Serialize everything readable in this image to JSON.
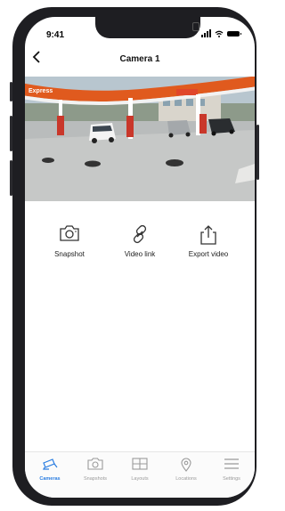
{
  "status_bar": {
    "time": "9:41"
  },
  "header": {
    "title": "Camera 1",
    "back_icon": "chevron-left-icon"
  },
  "video": {
    "description_icon": "camera-feed",
    "station_sign_left": "Express"
  },
  "actions": [
    {
      "label": "Snapshot",
      "icon": "camera-icon"
    },
    {
      "label": "Video link",
      "icon": "link-icon"
    },
    {
      "label": "Export video",
      "icon": "share-icon"
    }
  ],
  "tabs": [
    {
      "label": "Cameras",
      "icon": "cctv-icon",
      "active": true
    },
    {
      "label": "Snapshots",
      "icon": "camera-icon",
      "active": false
    },
    {
      "label": "Layouts",
      "icon": "grid-icon",
      "active": false
    },
    {
      "label": "Locations",
      "icon": "pin-icon",
      "active": false
    },
    {
      "label": "Settings",
      "icon": "menu-icon",
      "active": false
    }
  ],
  "colors": {
    "accent": "#2a7de1",
    "frame": "#1e1e22",
    "canopy": "#e05a1e"
  }
}
